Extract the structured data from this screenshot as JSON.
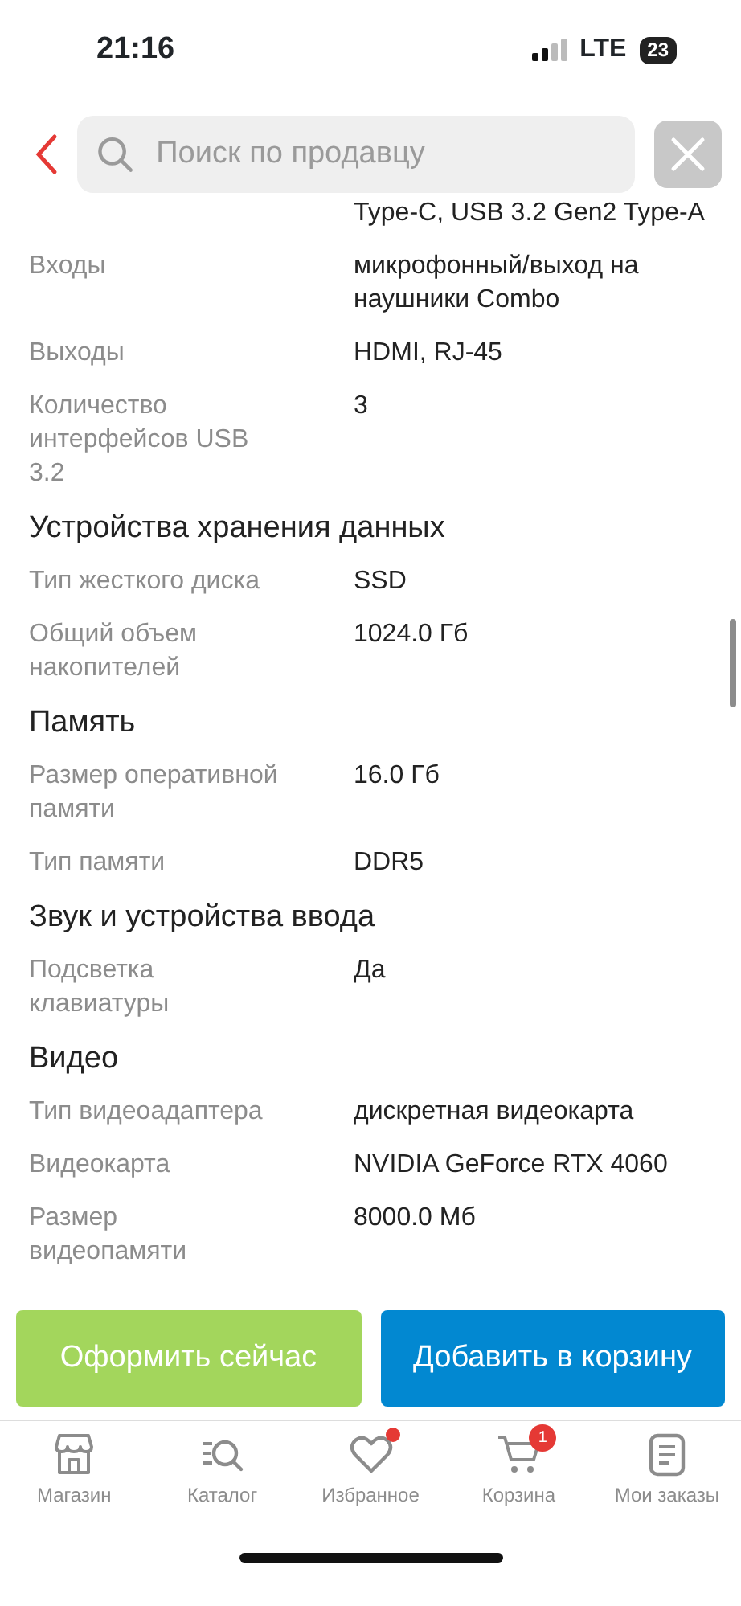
{
  "status_bar": {
    "time": "21:16",
    "network": "LTE",
    "battery": "23"
  },
  "header": {
    "search": {
      "placeholder": "Поиск по продавцу"
    }
  },
  "specs": [
    {
      "kind": "row",
      "value": "Type-C, USB 3.2 Gen2 Type-A"
    },
    {
      "kind": "row",
      "label": "Входы",
      "value": "микрофонный/выход на наушники Combo"
    },
    {
      "kind": "row",
      "label": "Выходы",
      "value": "HDMI, RJ-45"
    },
    {
      "kind": "row",
      "label": "Количество интерфейсов USB 3.2",
      "value": "3"
    },
    {
      "kind": "heading",
      "label": "Устройства хранения данных"
    },
    {
      "kind": "row",
      "label": "Тип жесткого диска",
      "value": "SSD"
    },
    {
      "kind": "row",
      "label": "Общий объем накопителей",
      "value": "1024.0 Гб"
    },
    {
      "kind": "heading",
      "label": "Память"
    },
    {
      "kind": "row",
      "label": "Размер оперативной памяти",
      "value": "16.0 Гб"
    },
    {
      "kind": "row",
      "label": "Тип памяти",
      "value": "DDR5"
    },
    {
      "kind": "heading",
      "label": "Звук и устройства ввода"
    },
    {
      "kind": "row",
      "label": "Подсветка клавиатуры",
      "value": "Да"
    },
    {
      "kind": "heading",
      "label": "Видео"
    },
    {
      "kind": "row",
      "label": "Тип видеоадаптера",
      "value": "дискретная видеокарта"
    },
    {
      "kind": "row",
      "label": "Видеокарта",
      "value": "NVIDIA GeForce RTX 4060"
    },
    {
      "kind": "row",
      "label": "Размер видеопамяти",
      "value": "8000.0 Мб"
    }
  ],
  "actions": [
    {
      "kind": "buy",
      "label": "Оформить сейчас"
    },
    {
      "kind": "cart",
      "label": "Добавить в корзину"
    }
  ],
  "tabs": [
    {
      "label": "Магазин",
      "dot": false
    },
    {
      "label": "Каталог",
      "dot": false
    },
    {
      "label": "Избранное",
      "dot": true
    },
    {
      "label": "Корзина",
      "dot": false,
      "badge": "1"
    },
    {
      "label": "Мои заказы",
      "dot": false
    }
  ]
}
